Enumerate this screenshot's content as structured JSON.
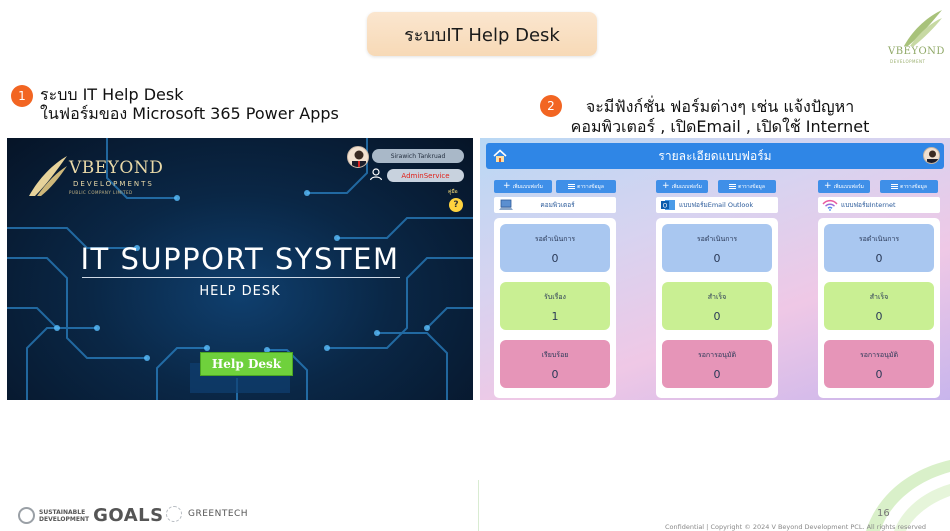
{
  "slide": {
    "title": "ระบบIT Help Desk",
    "page_number": "16",
    "copyright": "Confidential  |  Copyright ©  2024 V Beyond Development PCL. All rights reserved"
  },
  "brand": {
    "name": "VBEYOND",
    "tagline": "DEVELOPMENT"
  },
  "point1": {
    "number": "1",
    "line1": "ระบบ IT Help Desk",
    "line2": "ในฟอร์มของ Microsoft 365 Power Apps"
  },
  "point2": {
    "number": "2",
    "line1": "จะมีฟังก์ชั่น ฟอร์มต่างๆ เช่น แจ้งปัญหา",
    "line2": "คอมพิวเตอร์ , เปิดEmail , เปิดใช้ Internet"
  },
  "it_app": {
    "logo_name": "VBEYOND",
    "logo_sub": "DEVELOPMENTS",
    "logo_sub2": "PUBLIC COMPANY LIMITED",
    "user_name": "Sirawich Tankruad",
    "admin_label": "AdminService",
    "help_label": "คู่มือ",
    "help_icon": "?",
    "main_title": "IT SUPPORT SYSTEM",
    "sub_title": "HELP DESK",
    "button_label": "Help Desk"
  },
  "form_app": {
    "header_title": "รายละเอียดแบบฟอร์ม",
    "columns": [
      {
        "add_label": "เพิ่มแบบฟอร์ม",
        "table_label": "ตารางข้อมูล",
        "form_name": "คอมพิวเตอร์",
        "icon": "computer-icon",
        "cards": [
          {
            "label": "รอดำเนินการ",
            "value": "0",
            "color": "#a9c7f0"
          },
          {
            "label": "รับเรื่อง",
            "value": "1",
            "color": "#c9ef93"
          },
          {
            "label": "เรียบร้อย",
            "value": "0",
            "color": "#e695b8"
          }
        ]
      },
      {
        "add_label": "เพิ่มแบบฟอร์ม",
        "table_label": "ตารางข้อมูล",
        "form_name": "แบบฟอร์มEmail Outlook",
        "icon": "outlook-icon",
        "cards": [
          {
            "label": "รอดำเนินการ",
            "value": "0",
            "color": "#a9c7f0"
          },
          {
            "label": "สำเร็จ",
            "value": "0",
            "color": "#c9ef93"
          },
          {
            "label": "รอการอนุมัติ",
            "value": "0",
            "color": "#e695b8"
          }
        ]
      },
      {
        "add_label": "เพิ่มแบบฟอร์ม",
        "table_label": "ตารางข้อมูล",
        "form_name": "แบบฟอร์มInternet",
        "icon": "wifi-icon",
        "cards": [
          {
            "label": "รอดำเนินการ",
            "value": "0",
            "color": "#a9c7f0"
          },
          {
            "label": "สำเร็จ",
            "value": "0",
            "color": "#c9ef93"
          },
          {
            "label": "รอการอนุมัติ",
            "value": "0",
            "color": "#e695b8"
          }
        ]
      }
    ]
  },
  "footer": {
    "sdg_line1": "SUSTAINABLE",
    "sdg_line2": "DEVELOPMENT",
    "sdg_goals": "GOALS",
    "greentech": "GREENTECH"
  },
  "colors": {
    "accent_orange": "#f26522",
    "pill_bg": "#f7d9b6",
    "header_blue": "#2f86e6",
    "button_green": "#6fd13c"
  }
}
